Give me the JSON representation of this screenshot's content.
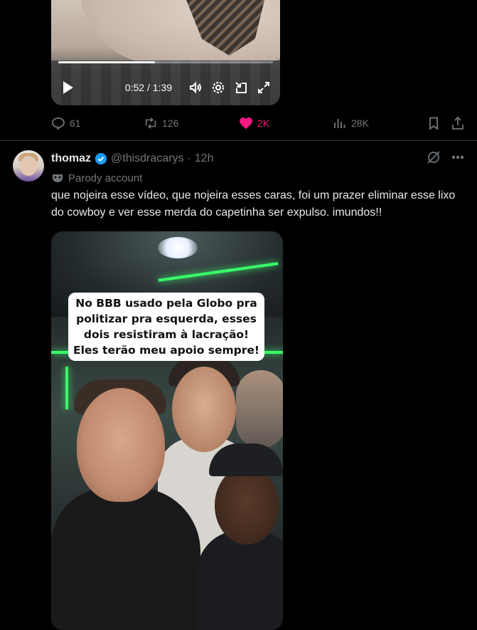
{
  "prev_video": {
    "time": "0:52 / 1:39",
    "progress": 0.45,
    "controls": [
      "play-icon",
      "volume-icon",
      "settings-icon",
      "minimize-icon",
      "fullscreen-icon"
    ]
  },
  "prev_actions": {
    "replies": "61",
    "reposts": "126",
    "likes": "2K",
    "views": "28K",
    "like_color": "#f91880"
  },
  "tweet": {
    "name": "thomaz",
    "handle": "@thisdracarys",
    "separator": "·",
    "time": "12h",
    "label": "Parody account",
    "text": "que nojeira esse vídeo, que nojeira esses caras, foi um prazer eliminar esse lixo do cowboy e ver esse merda do capetinha ser expulso. imundos!!",
    "verified_color": "#1d9bf0",
    "video_caption": "No BBB usado pela Globo pra politizar pra esquerda, esses dois resistiram à lacração! Eles terão meu apoio sempre!"
  },
  "colors": {
    "background": "#000000",
    "text": "#e7e9ea",
    "muted": "#71767b",
    "divider": "#2f3336"
  }
}
